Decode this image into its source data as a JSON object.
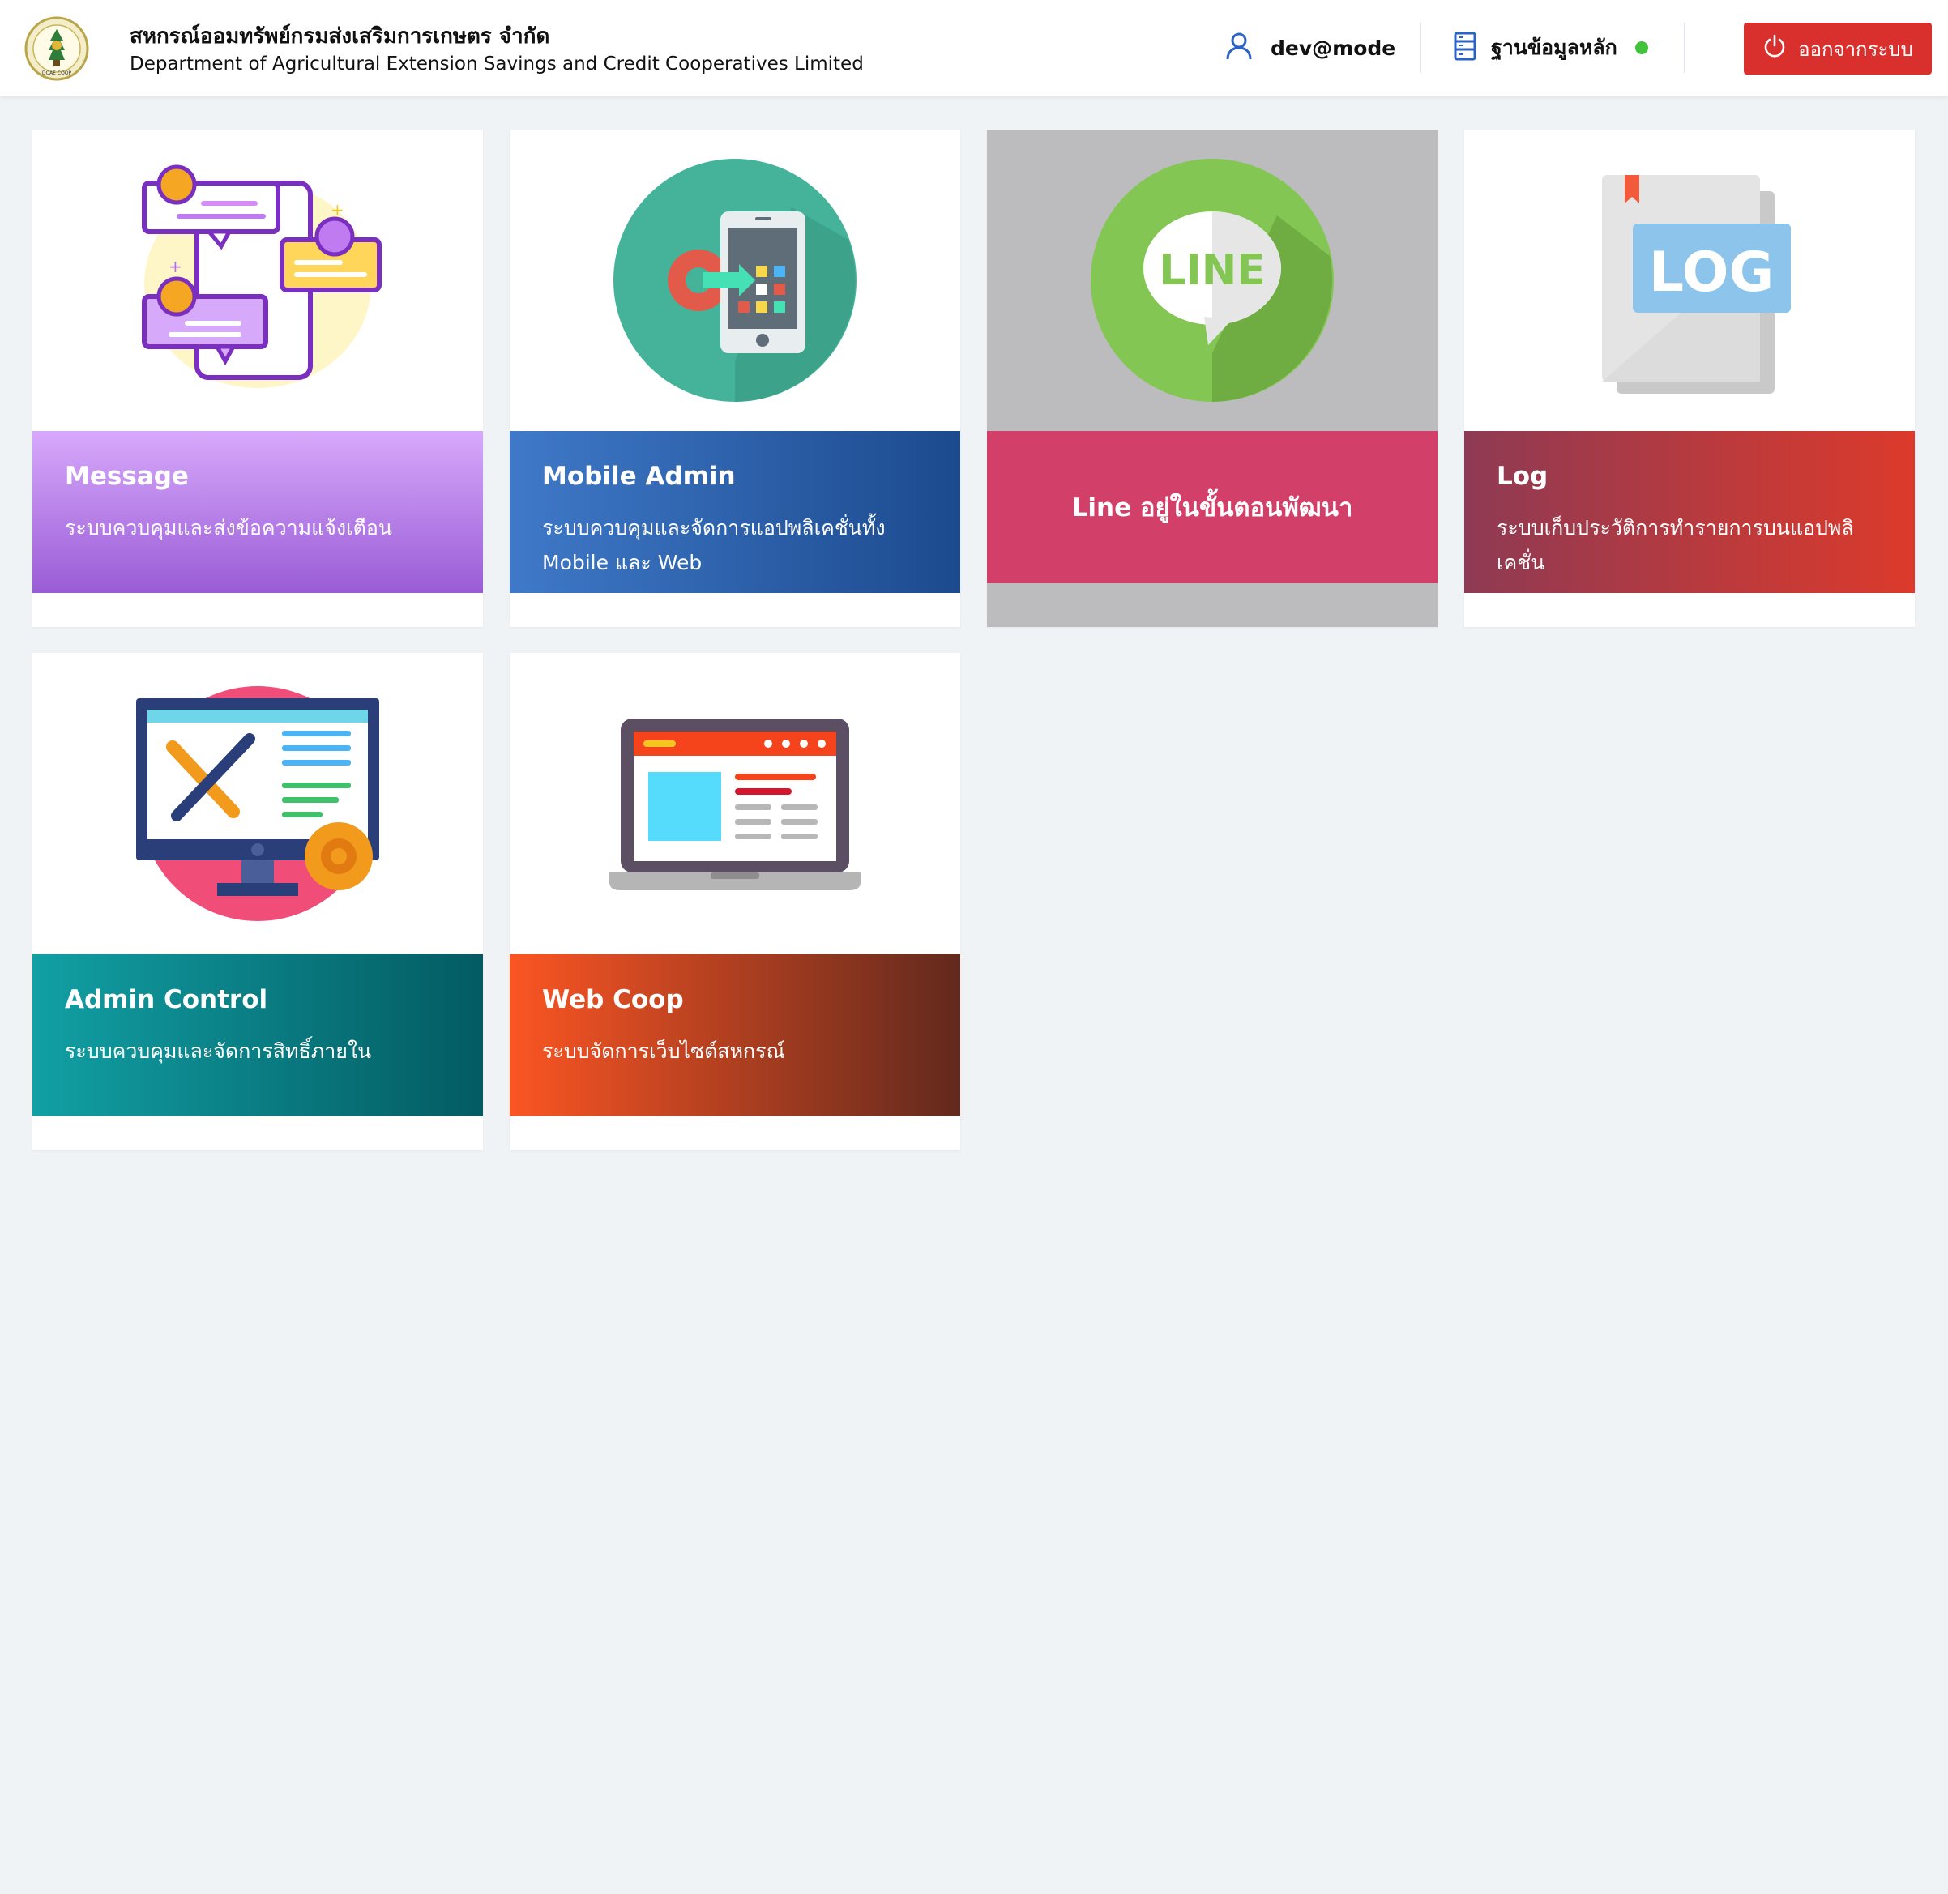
{
  "header": {
    "org_name_th": "สหกรณ์ออมทรัพย์กรมส่งเสริมการเกษตร จำกัด",
    "org_name_en": "Department of Agricultural Extension Savings and Credit Cooperatives Limited",
    "logo_text": "DOAE COOP",
    "user": {
      "name": "dev@mode",
      "icon": "user-icon"
    },
    "database": {
      "label": "ฐานข้อมูลหลัก",
      "icon": "database-icon",
      "status_color": "#43c23b"
    },
    "logout": {
      "label": "ออกจากระบบ",
      "icon": "power-icon",
      "color": "#d9302e"
    }
  },
  "cards": [
    {
      "id": "message",
      "title": "Message",
      "description": "ระบบควบคุมและส่งข้อความแจ้งเตือน",
      "illustration": "chat-messages-illustration",
      "gradient": [
        "#d7a9fb",
        "#9a5cd6"
      ],
      "enabled": true
    },
    {
      "id": "mobile-admin",
      "title": "Mobile Admin",
      "description": "ระบบควบคุมและจัดการแอปพลิเคชั่นทั้ง Mobile และ Web",
      "illustration": "mobile-settings-illustration",
      "gradient": [
        "#3f79c8",
        "#1c4a8e"
      ],
      "enabled": true
    },
    {
      "id": "line",
      "title": "Line อยู่ในขั้นตอนพัฒนา",
      "description": "",
      "illustration": "line-logo-illustration",
      "illustration_text": "LINE",
      "band_color": "#d2406a",
      "enabled": false
    },
    {
      "id": "log",
      "title": "Log",
      "description": "ระบบเก็บประวัติการทำรายการบนแอปพลิเคชั่น",
      "illustration": "log-document-illustration",
      "illustration_text": "LOG",
      "gradient": [
        "#8e3a54",
        "#dc3a2b"
      ],
      "enabled": true
    },
    {
      "id": "admin-control",
      "title": "Admin Control",
      "description": "ระบบควบคุมและจัดการสิทธิ์ภายใน",
      "illustration": "admin-tools-illustration",
      "gradient": [
        "#11a0a4",
        "#035b62"
      ],
      "enabled": true
    },
    {
      "id": "web-coop",
      "title": "Web Coop",
      "description": "ระบบจัดการเว็บไซต์สหกรณ์",
      "illustration": "laptop-website-illustration",
      "gradient": [
        "#fb5523",
        "#62291d"
      ],
      "enabled": true
    }
  ]
}
